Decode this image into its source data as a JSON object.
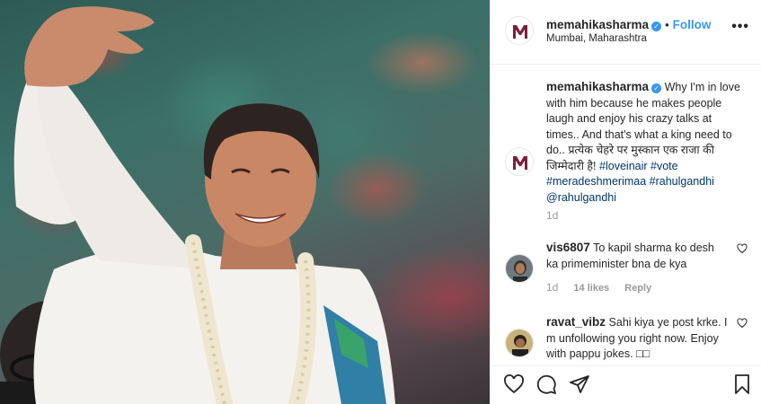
{
  "post": {
    "username": "memahikasharma",
    "follow_label": "Follow",
    "location": "Mumbai, Maharashtra",
    "more_label": "•••"
  },
  "caption": {
    "username": "memahikasharma",
    "text_before_tags": "Why I'm in love with him because he makes people laugh and enjoy his crazy talks at times.. And that's what a king need to do.. प्रत्येक चेहरे पर मुस्कान एक राजा की जिम्मेदारी है!",
    "tags": [
      "#loveinair",
      "#vote",
      "#meradeshmerimaa",
      "#rahulgandhi",
      "@rahulgandhi"
    ],
    "time": "1d"
  },
  "comments": [
    {
      "username": "vis6807",
      "text": "To kapil sharma ko desh ka primeminister bna de kya",
      "time": "1d",
      "likes": "14 likes",
      "reply_label": "Reply"
    },
    {
      "username": "ravat_vibz",
      "text": "Sahi kiya ye post krke. I m unfollowing you right now. Enjoy with pappu jokes. □□"
    }
  ],
  "icons": {
    "like": "heart-icon",
    "comment": "comment-icon",
    "share": "share-icon",
    "save": "bookmark-icon"
  },
  "colors": {
    "link_blue": "#3897f0",
    "hashtag": "#003569",
    "muted": "#999999",
    "border": "#efefef"
  }
}
